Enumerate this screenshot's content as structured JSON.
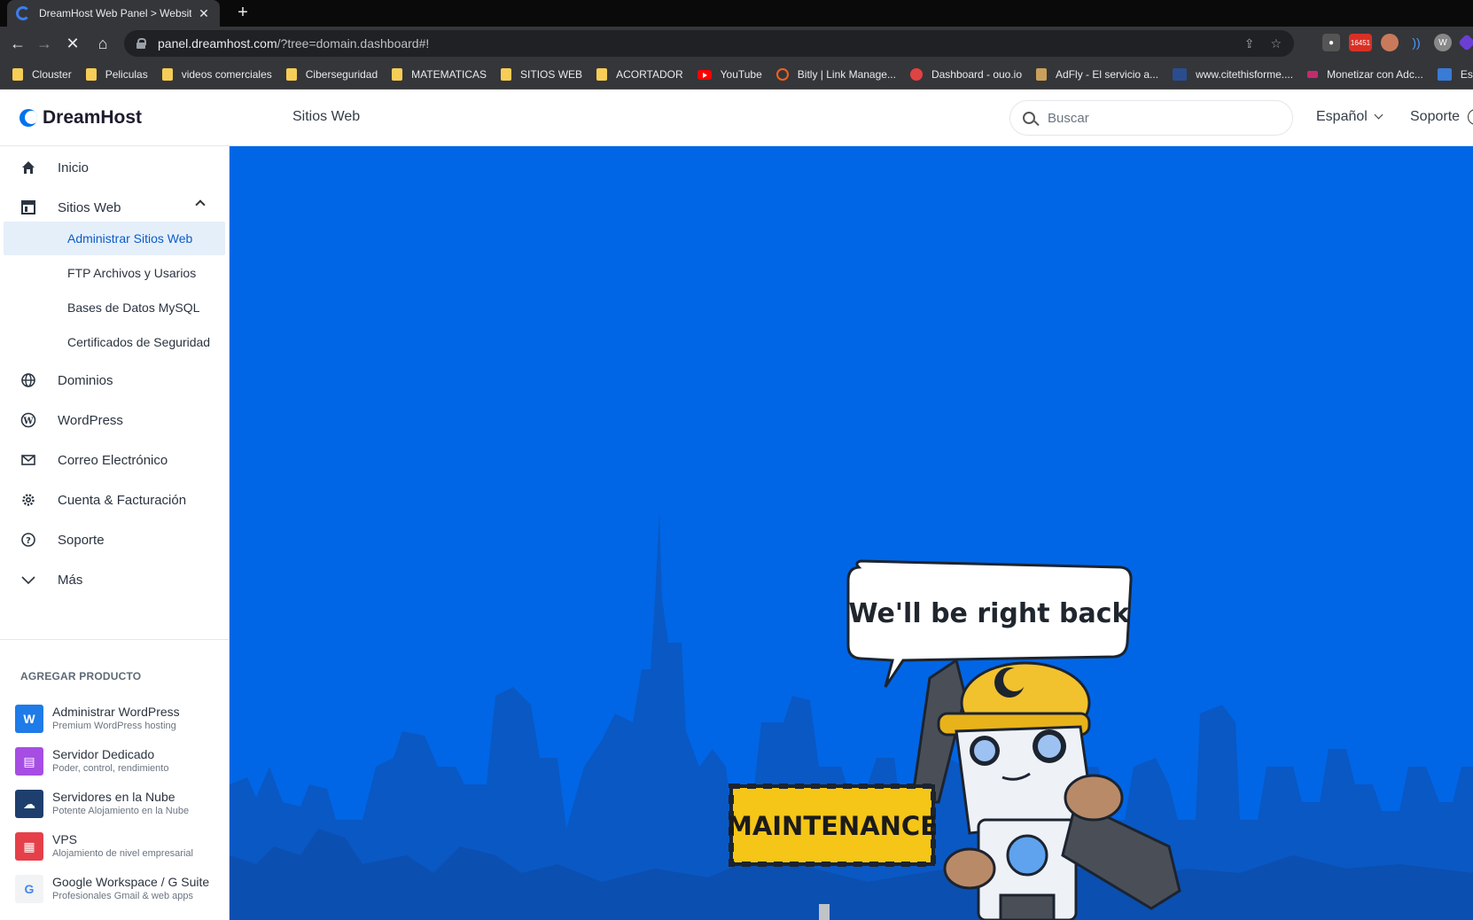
{
  "browser": {
    "tab_title": "DreamHost Web Panel > Website",
    "new_tab": "+",
    "url_host": "panel.dreamhost.com",
    "url_path": "/?tree=domain.dashboard#!",
    "ext_badge": "16451",
    "bookmarks": [
      {
        "label": "Clouster",
        "icon": "folder"
      },
      {
        "label": "Peliculas",
        "icon": "folder"
      },
      {
        "label": "videos comerciales",
        "icon": "folder"
      },
      {
        "label": "Ciberseguridad",
        "icon": "folder"
      },
      {
        "label": "MATEMATICAS",
        "icon": "folder"
      },
      {
        "label": "SITIOS WEB",
        "icon": "folder"
      },
      {
        "label": "ACORTADOR",
        "icon": "folder"
      },
      {
        "label": "YouTube",
        "icon": "youtube"
      },
      {
        "label": "Bitly | Link Manage...",
        "icon": "bitly"
      },
      {
        "label": "Dashboard - ouo.io",
        "icon": "ouo"
      },
      {
        "label": "AdFly - El servicio a...",
        "icon": "adfly"
      },
      {
        "label": "www.citethisforme....",
        "icon": "cite"
      },
      {
        "label": "Monetizar con Adc...",
        "icon": "adcash"
      },
      {
        "label": "Escrito",
        "icon": "escrito"
      }
    ]
  },
  "header": {
    "brand": "DreamHost",
    "section": "Sitios Web",
    "search_placeholder": "Buscar",
    "language": "Español",
    "support": "Soporte"
  },
  "sidebar": {
    "items": [
      {
        "label": "Inicio",
        "icon": "home-icon"
      },
      {
        "label": "Sitios Web",
        "icon": "websites-icon"
      },
      {
        "label": "Dominios",
        "icon": "globe-icon"
      },
      {
        "label": "WordPress",
        "icon": "wordpress-icon"
      },
      {
        "label": "Correo Electrónico",
        "icon": "mail-icon"
      },
      {
        "label": "Cuenta & Facturación",
        "icon": "gear-icon"
      },
      {
        "label": "Soporte",
        "icon": "help-icon"
      },
      {
        "label": "Más",
        "icon": "chevron-down-icon"
      }
    ],
    "subitems": [
      {
        "label": "Administrar Sitios Web",
        "active": true
      },
      {
        "label": "FTP Archivos y Usarios",
        "active": false
      },
      {
        "label": "Bases de Datos MySQL",
        "active": false
      },
      {
        "label": "Certificados de Seguridad",
        "active": false
      }
    ],
    "add_product_heading": "AGREGAR PRODUCTO",
    "products": [
      {
        "name": "Administrar WordPress",
        "desc": "Premium WordPress hosting",
        "color": "#1e7be8"
      },
      {
        "name": "Servidor Dedicado",
        "desc": "Poder, control, rendimiento",
        "color": "#a64ee3"
      },
      {
        "name": "Servidores en la Nube",
        "desc": "Potente Alojamiento en la Nube",
        "color": "#1e3e6e"
      },
      {
        "name": "VPS",
        "desc": "Alojamiento de nivel empresarial",
        "color": "#e5404a"
      },
      {
        "name": "Google Workspace / G Suite",
        "desc": "Profesionales Gmail & web apps",
        "color": "#f1f3f4"
      }
    ]
  },
  "maintenance": {
    "bubble": "We'll be right back",
    "sign": "MAINTENANCE"
  },
  "colors": {
    "accent": "#0073ec",
    "maintenance_bg": "#0066e6",
    "skyline": "#0a55b8"
  }
}
